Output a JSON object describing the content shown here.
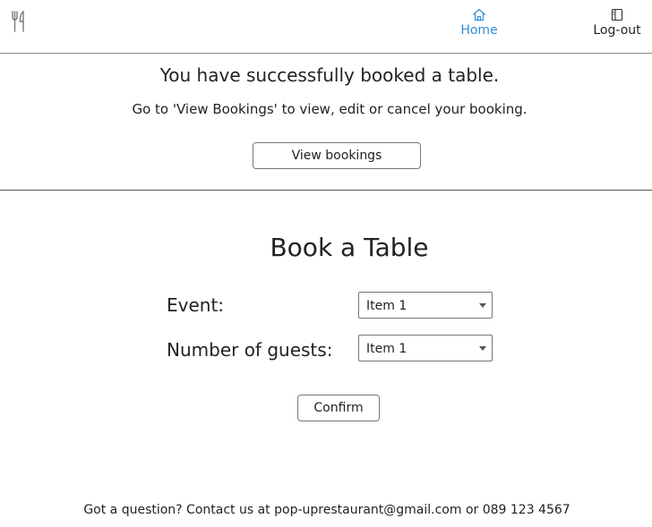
{
  "header": {
    "logo_icon": "fork-knife-icon",
    "nav": {
      "home": {
        "label": "Home",
        "icon": "home-icon",
        "color": "#2f8fd6"
      },
      "logout": {
        "label": "Log-out",
        "icon": "logout-icon"
      }
    }
  },
  "success": {
    "title": "You have successfully booked a table.",
    "subtitle": "Go to 'View Bookings' to view, edit or cancel your booking.",
    "view_button": "View bookings"
  },
  "booking_form": {
    "title": "Book a Table",
    "event_label": "Event:",
    "event_value": "Item 1",
    "guests_label": "Number of guests:",
    "guests_value": "Item 1",
    "confirm_button": "Confirm"
  },
  "footer": {
    "contact_text": "Got a question? Contact us at pop-uprestaurant@gmail.com or 089 123 4567"
  }
}
